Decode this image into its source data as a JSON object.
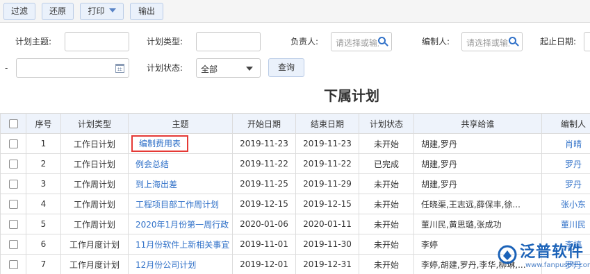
{
  "toolbar": {
    "filter": "过滤",
    "restore": "还原",
    "print": "打印",
    "export": "输出"
  },
  "filters": {
    "subject_label": "计划主题:",
    "type_label": "计划类型:",
    "owner_label": "负责人:",
    "owner_placeholder": "请选择或输入",
    "editor_label": "编制人:",
    "editor_placeholder": "请选择或输入",
    "date_label": "起止日期:",
    "date_sep": "-",
    "status_label": "计划状态:",
    "status_value": "全部",
    "query": "查询"
  },
  "page_title": "下属计划",
  "table": {
    "headers": [
      "序号",
      "计划类型",
      "主题",
      "开始日期",
      "结束日期",
      "计划状态",
      "共享给谁",
      "编制人"
    ],
    "rows": [
      {
        "no": "1",
        "type": "工作日计划",
        "subject": "编制费用表",
        "start": "2019-11-23",
        "end": "2019-11-23",
        "status": "未开始",
        "share": "胡建,罗丹",
        "editor": "肖晴"
      },
      {
        "no": "2",
        "type": "工作日计划",
        "subject": "例会总结",
        "start": "2019-11-22",
        "end": "2019-11-22",
        "status": "已完成",
        "share": "胡建,罗丹",
        "editor": "罗丹"
      },
      {
        "no": "3",
        "type": "工作周计划",
        "subject": "到上海出差",
        "start": "2019-11-25",
        "end": "2019-11-29",
        "status": "未开始",
        "share": "胡建,罗丹",
        "editor": "罗丹"
      },
      {
        "no": "4",
        "type": "工作周计划",
        "subject": "工程项目部工作周计划",
        "start": "2019-12-15",
        "end": "2019-12-15",
        "status": "未开始",
        "share": "任晓渠,王志远,薛保丰,徐...",
        "editor": "张小东"
      },
      {
        "no": "5",
        "type": "工作周计划",
        "subject": "2020年1月份第一周行政",
        "start": "2020-01-06",
        "end": "2020-01-11",
        "status": "未开始",
        "share": "董川民,黄思璐,张成功",
        "editor": "董川民"
      },
      {
        "no": "6",
        "type": "工作月度计划",
        "subject": "11月份软件上新相关事宜",
        "start": "2019-11-01",
        "end": "2019-11-30",
        "status": "未开始",
        "share": "李婷",
        "editor": "李婷"
      },
      {
        "no": "7",
        "type": "工作月度计划",
        "subject": "12月份公司计划",
        "start": "2019-12-01",
        "end": "2019-12-31",
        "status": "未开始",
        "share": "李婷,胡建,罗丹,李华,柳琳,...",
        "editor": "罗丹"
      }
    ]
  },
  "watermark": {
    "name": "泛普软件",
    "url": "www.fanpusoft.com"
  },
  "colors": {
    "link": "#2f70c8",
    "highlight_box": "#e53935",
    "header_bg": "#eef3fb",
    "button_bg": "#eaf1fb"
  }
}
